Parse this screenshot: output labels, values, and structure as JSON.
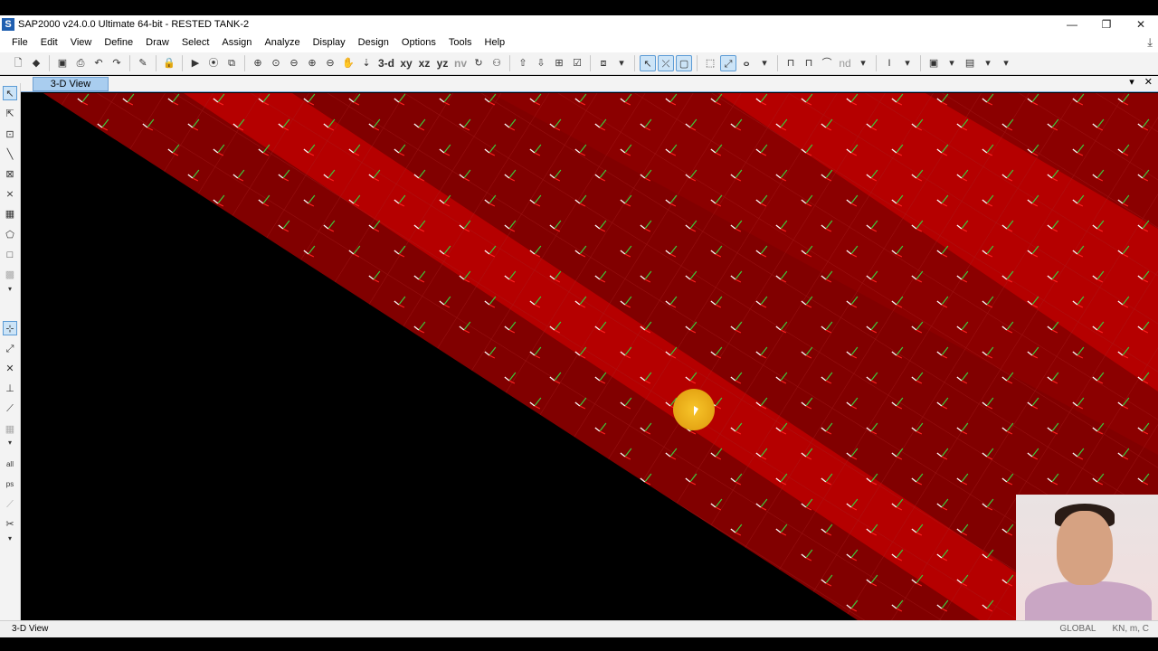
{
  "window": {
    "title": "SAP2000 v24.0.0 Ultimate 64-bit - RESTED TANK-2",
    "app_icon": "S",
    "controls": [
      "—",
      "❐",
      "✕"
    ]
  },
  "menu": [
    "File",
    "Edit",
    "View",
    "Define",
    "Draw",
    "Select",
    "Assign",
    "Analyze",
    "Display",
    "Design",
    "Options",
    "Tools",
    "Help"
  ],
  "toolbar": {
    "view_3d": "3-d",
    "view_xy": "xy",
    "view_xz": "xz",
    "view_yz": "yz",
    "view_nv": "nv",
    "label_nd": "nd"
  },
  "tab": {
    "label": "3-D View"
  },
  "status": {
    "view_label": "3-D View",
    "coord_system": "GLOBAL",
    "units": "KN, m, C"
  },
  "colors": {
    "shell_fill": "#8b0000",
    "shell_band": "#c40000",
    "grid_line": "#a31818",
    "local_axis_1": "#ff2020",
    "local_axis_2": "#ffffff",
    "local_axis_3": "#3cc83c",
    "cursor_highlight": "#f2b71a"
  }
}
